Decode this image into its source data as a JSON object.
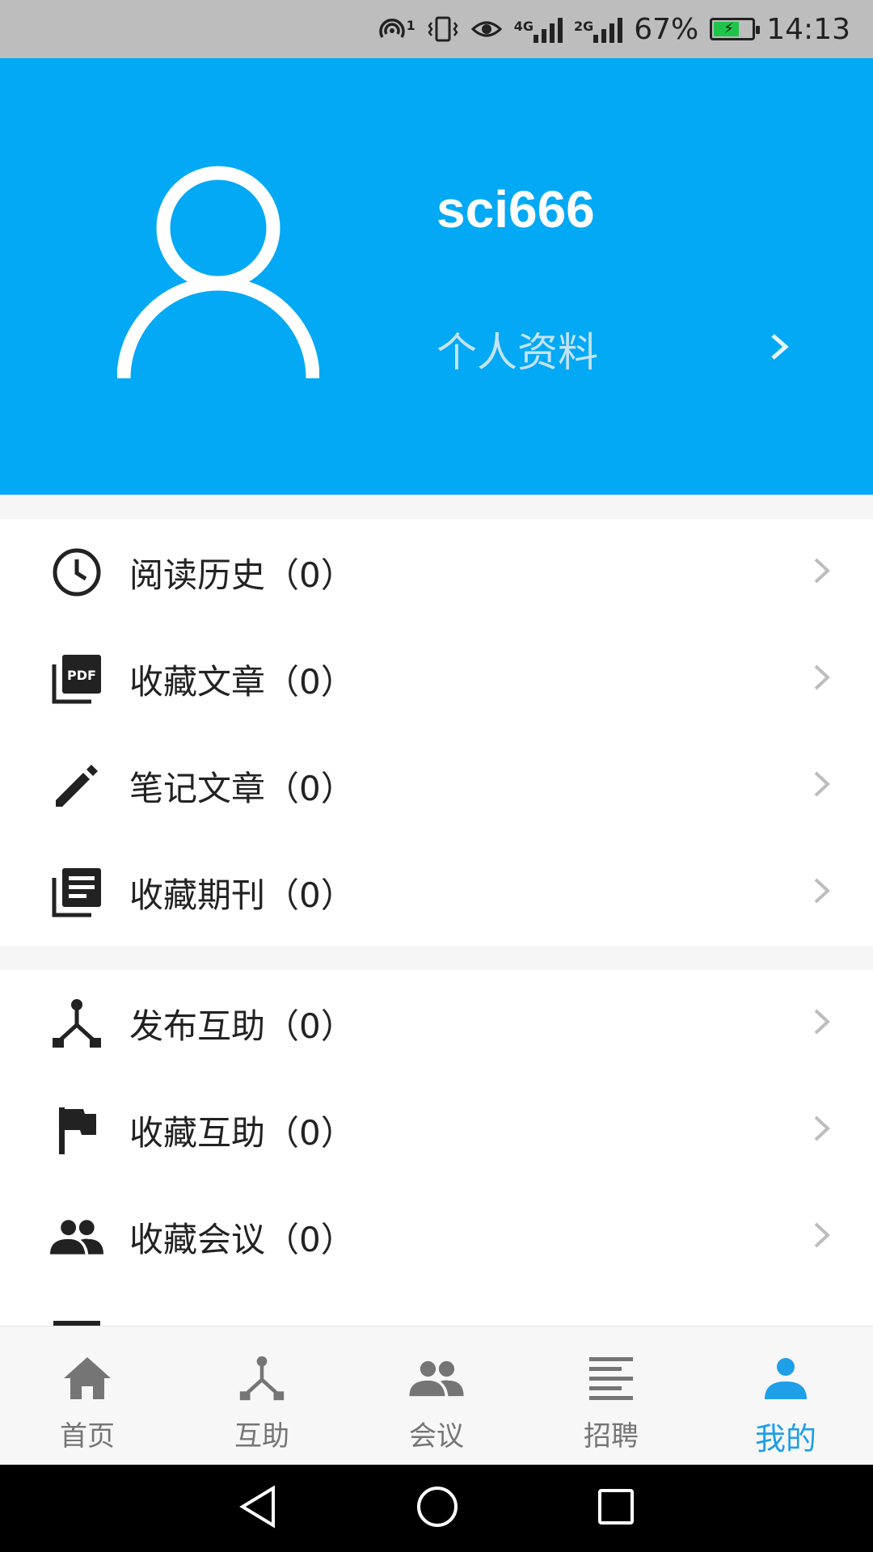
{
  "status_bar": {
    "hotspot_badge": "1",
    "net1": "4G",
    "net2": "2G",
    "battery": "67%",
    "time": "14:13",
    "battery_color": "#21c44a"
  },
  "header": {
    "username": "sci666",
    "profile_label": "个人资料",
    "background": "#03a9f4"
  },
  "group1": [
    {
      "icon": "clock-icon",
      "label": "阅读历史（0）"
    },
    {
      "icon": "pdf-icon",
      "label": "收藏文章（0）"
    },
    {
      "icon": "pencil-icon",
      "label": "笔记文章（0）"
    },
    {
      "icon": "journal-icon",
      "label": "收藏期刊（0）"
    }
  ],
  "group2": [
    {
      "icon": "branch-icon",
      "label": "发布互助（0）"
    },
    {
      "icon": "flag-icon",
      "label": "收藏互助（0）"
    },
    {
      "icon": "people-icon",
      "label": "收藏会议（0）"
    }
  ],
  "bottom_nav": [
    {
      "icon": "home-icon",
      "label": "首页",
      "active": false
    },
    {
      "icon": "branch-icon",
      "label": "互助",
      "active": false
    },
    {
      "icon": "people-icon",
      "label": "会议",
      "active": false
    },
    {
      "icon": "list-icon",
      "label": "招聘",
      "active": false
    },
    {
      "icon": "person-icon",
      "label": "我的",
      "active": true
    }
  ],
  "colors": {
    "active_tab": "#1e9fe8",
    "inactive_tab": "#757575"
  }
}
